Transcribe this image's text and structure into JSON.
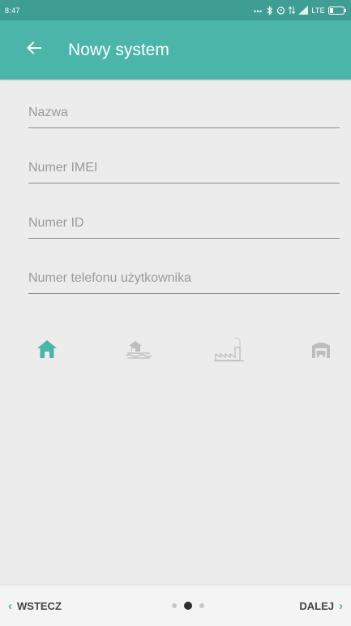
{
  "status_bar": {
    "time": "8:47",
    "network": "LTE"
  },
  "app_bar": {
    "title": "Nowy system",
    "back_icon": "arrow-back-icon"
  },
  "form": {
    "fields": [
      {
        "placeholder": "Nazwa",
        "value": ""
      },
      {
        "placeholder": "Numer IMEI",
        "value": ""
      },
      {
        "placeholder": "Numer ID",
        "value": ""
      },
      {
        "placeholder": "Numer telefonu użytkownika",
        "value": ""
      }
    ]
  },
  "system_types": [
    {
      "icon": "house-icon",
      "selected": true
    },
    {
      "icon": "lake-house-icon",
      "selected": false
    },
    {
      "icon": "factory-icon",
      "selected": false
    },
    {
      "icon": "garage-icon",
      "selected": false
    }
  ],
  "colors": {
    "accent": "#4cb5a9",
    "status_bar": "#3f9e94",
    "inactive_icon": "#bdbdbd"
  },
  "bottom_nav": {
    "back_label": "WSTECZ",
    "next_label": "DALEJ",
    "page_count": 3,
    "current_page": 2
  }
}
